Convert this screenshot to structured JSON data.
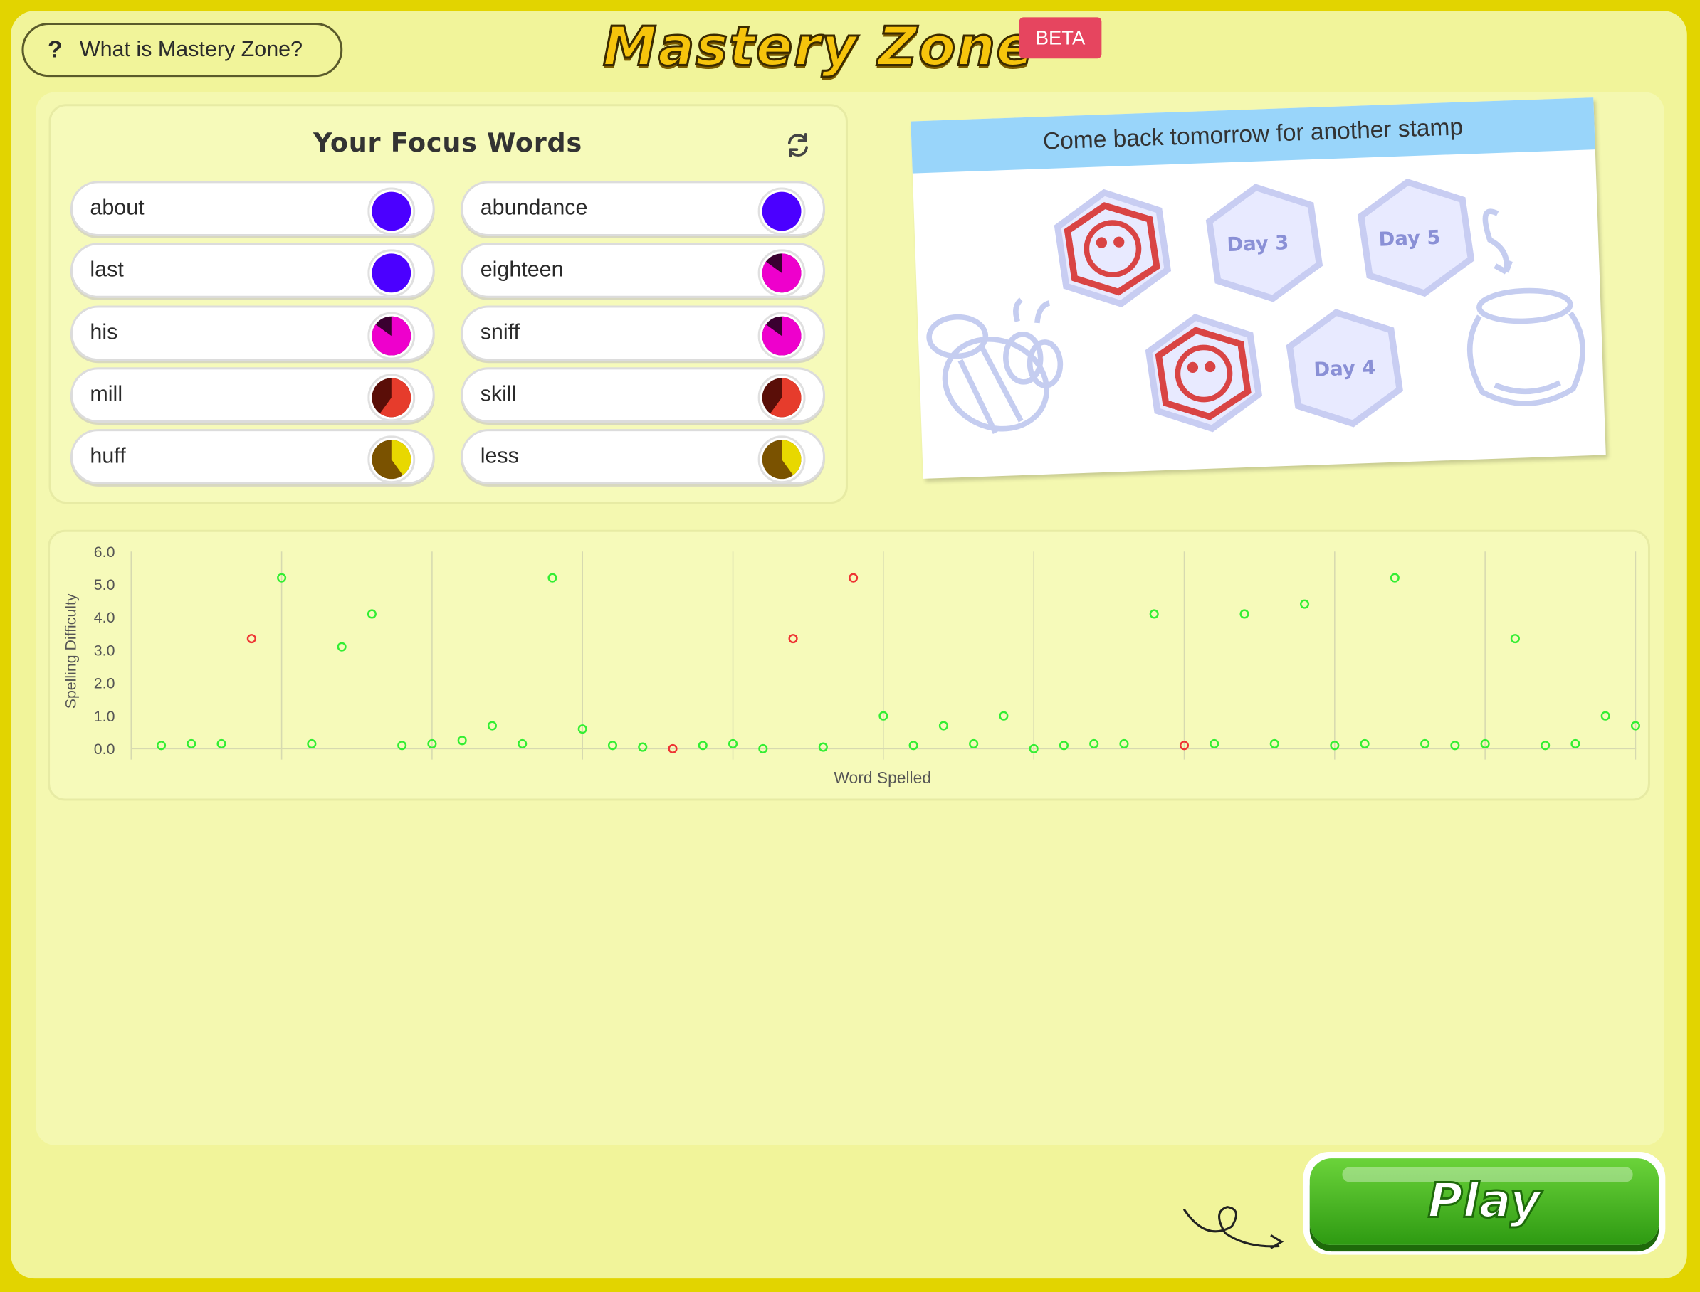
{
  "header": {
    "help_button": "What is Mastery Zone?",
    "help_icon": "?",
    "title": "Mastery Zone",
    "badge": "BETA"
  },
  "focus_words": {
    "title": "Your Focus Words",
    "refresh_icon": "refresh-icon",
    "words": [
      {
        "word": "about",
        "color": "#4b00ff",
        "progress": 1.0,
        "dark": "#2a0090"
      },
      {
        "word": "abundance",
        "color": "#4b00ff",
        "progress": 1.0,
        "dark": "#2a0090"
      },
      {
        "word": "last",
        "color": "#4b00ff",
        "progress": 1.0,
        "dark": "#2a0090"
      },
      {
        "word": "eighteen",
        "color": "#ee00cc",
        "progress": 0.85,
        "dark": "#3a0030"
      },
      {
        "word": "his",
        "color": "#ee00cc",
        "progress": 0.85,
        "dark": "#3a0030"
      },
      {
        "word": "sniff",
        "color": "#ee00cc",
        "progress": 0.85,
        "dark": "#3a0030"
      },
      {
        "word": "mill",
        "color": "#e63c2c",
        "progress": 0.6,
        "dark": "#5a0e08"
      },
      {
        "word": "skill",
        "color": "#e63c2c",
        "progress": 0.6,
        "dark": "#5a0e08"
      },
      {
        "word": "huff",
        "color": "#e8d800",
        "progress": 0.4,
        "dark": "#7a5200"
      },
      {
        "word": "less",
        "color": "#e8d800",
        "progress": 0.4,
        "dark": "#7a5200"
      }
    ]
  },
  "stamps": {
    "banner": "Come back tomorrow for another stamp",
    "day_labels": [
      "Day 3",
      "Day 5",
      "Day 4"
    ]
  },
  "chart_data": {
    "type": "scatter",
    "xlabel": "Word Spelled",
    "ylabel": "Spelling Difficulty",
    "ylim": [
      0,
      6
    ],
    "ytick_labels": [
      "0.0",
      "1.0",
      "2.0",
      "3.0",
      "4.0",
      "5.0",
      "6.0"
    ],
    "grid": true,
    "correct_color": "#33ee33",
    "incorrect_color": "#ee3333",
    "points": [
      {
        "x": 1,
        "y": 0.1,
        "correct": true
      },
      {
        "x": 2,
        "y": 0.15,
        "correct": true
      },
      {
        "x": 3,
        "y": 0.15,
        "correct": true
      },
      {
        "x": 4,
        "y": 3.35,
        "correct": false
      },
      {
        "x": 5,
        "y": 5.2,
        "correct": true
      },
      {
        "x": 6,
        "y": 0.15,
        "correct": true
      },
      {
        "x": 7,
        "y": 3.1,
        "correct": true
      },
      {
        "x": 8,
        "y": 4.1,
        "correct": true
      },
      {
        "x": 9,
        "y": 0.1,
        "correct": true
      },
      {
        "x": 10,
        "y": 0.15,
        "correct": true
      },
      {
        "x": 11,
        "y": 0.25,
        "correct": true
      },
      {
        "x": 12,
        "y": 0.7,
        "correct": true
      },
      {
        "x": 13,
        "y": 0.15,
        "correct": true
      },
      {
        "x": 14,
        "y": 5.2,
        "correct": true
      },
      {
        "x": 15,
        "y": 0.6,
        "correct": true
      },
      {
        "x": 16,
        "y": 0.1,
        "correct": true
      },
      {
        "x": 17,
        "y": 0.05,
        "correct": true
      },
      {
        "x": 18,
        "y": 0.0,
        "correct": false
      },
      {
        "x": 19,
        "y": 0.1,
        "correct": true
      },
      {
        "x": 20,
        "y": 0.15,
        "correct": true
      },
      {
        "x": 21,
        "y": 0.0,
        "correct": true
      },
      {
        "x": 22,
        "y": 3.35,
        "correct": false
      },
      {
        "x": 23,
        "y": 0.05,
        "correct": true
      },
      {
        "x": 24,
        "y": 5.2,
        "correct": false
      },
      {
        "x": 25,
        "y": 1.0,
        "correct": true
      },
      {
        "x": 26,
        "y": 0.1,
        "correct": true
      },
      {
        "x": 27,
        "y": 0.7,
        "correct": true
      },
      {
        "x": 28,
        "y": 0.15,
        "correct": true
      },
      {
        "x": 29,
        "y": 1.0,
        "correct": true
      },
      {
        "x": 30,
        "y": 0.0,
        "correct": true
      },
      {
        "x": 31,
        "y": 0.1,
        "correct": true
      },
      {
        "x": 32,
        "y": 0.15,
        "correct": true
      },
      {
        "x": 33,
        "y": 0.15,
        "correct": true
      },
      {
        "x": 34,
        "y": 4.1,
        "correct": true
      },
      {
        "x": 35,
        "y": 0.1,
        "correct": false
      },
      {
        "x": 36,
        "y": 0.15,
        "correct": true
      },
      {
        "x": 37,
        "y": 4.1,
        "correct": true
      },
      {
        "x": 38,
        "y": 0.15,
        "correct": true
      },
      {
        "x": 39,
        "y": 4.4,
        "correct": true
      },
      {
        "x": 40,
        "y": 0.1,
        "correct": true
      },
      {
        "x": 41,
        "y": 0.15,
        "correct": true
      },
      {
        "x": 42,
        "y": 5.2,
        "correct": true
      },
      {
        "x": 43,
        "y": 0.15,
        "correct": true
      },
      {
        "x": 44,
        "y": 0.1,
        "correct": true
      },
      {
        "x": 45,
        "y": 0.15,
        "correct": true
      },
      {
        "x": 46,
        "y": 3.35,
        "correct": true
      },
      {
        "x": 47,
        "y": 0.1,
        "correct": true
      },
      {
        "x": 48,
        "y": 0.15,
        "correct": true
      },
      {
        "x": 49,
        "y": 1.0,
        "correct": true
      },
      {
        "x": 50,
        "y": 0.7,
        "correct": true
      }
    ]
  },
  "play_button": "Play"
}
